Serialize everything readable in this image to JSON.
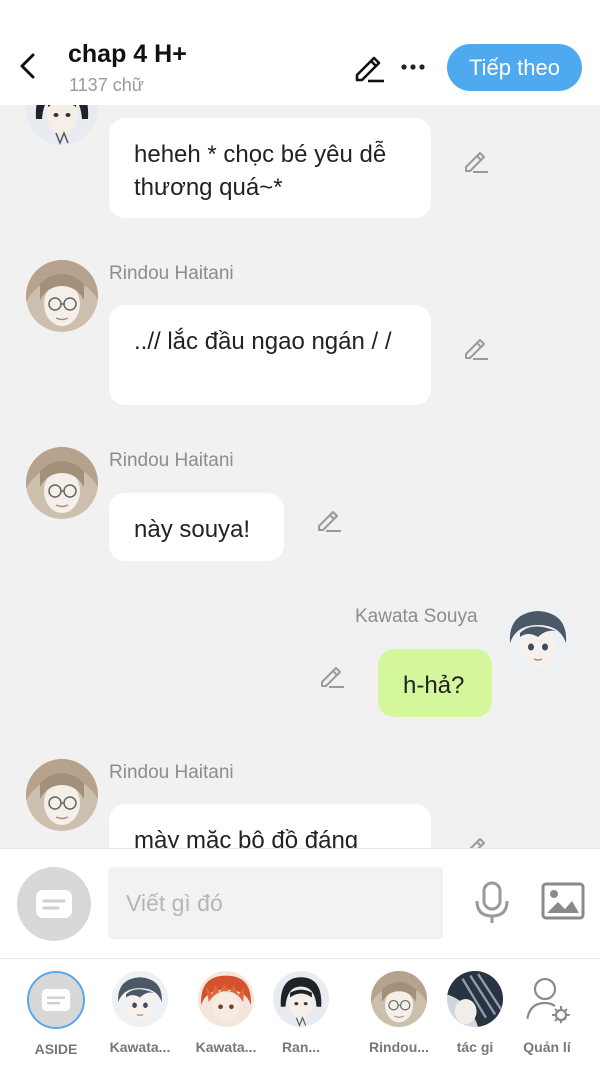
{
  "header": {
    "title": "chap 4 H+",
    "word_count": "1137 chữ",
    "next_label": "Tiếp theo",
    "accent": "#4ea9ef"
  },
  "messages": [
    {
      "sender": "",
      "text": "heheh * chọc bé yêu dễ thương quá~*",
      "side": "left",
      "character": "ran-haitani"
    },
    {
      "sender": "Rindou Haitani",
      "text": "..// lắc đầu ngao ngán / /",
      "side": "left",
      "character": "rindou-haitani"
    },
    {
      "sender": "Rindou Haitani",
      "text": "này souya!",
      "side": "left",
      "character": "rindou-haitani"
    },
    {
      "sender": "Kawata Souya",
      "text": "h-hả?",
      "side": "right",
      "character": "kawata-souya"
    },
    {
      "sender": "Rindou Haitani",
      "text": "mày mặc bộ đồ đáng",
      "side": "left",
      "character": "rindou-haitani"
    }
  ],
  "composer": {
    "placeholder": "Viết gì đó"
  },
  "characters": [
    {
      "label": "ASIDE"
    },
    {
      "label": "Kawata..."
    },
    {
      "label": "Kawata..."
    },
    {
      "label": "Ran..."
    },
    {
      "label": "Rindou..."
    },
    {
      "label": "tác gi"
    },
    {
      "label": "Quản lí"
    }
  ],
  "colors": {
    "my_bubble": "#d5f79b",
    "other_bubble": "#ffffff",
    "background": "#f1f1f1"
  }
}
